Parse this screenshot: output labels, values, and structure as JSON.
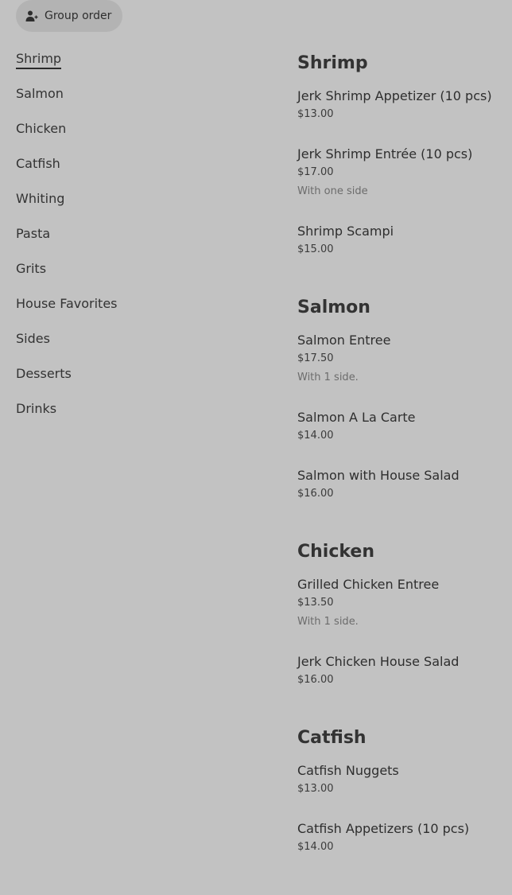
{
  "group_order": {
    "label": "Group order",
    "icon": "person-add-icon"
  },
  "nav": {
    "items": [
      {
        "label": "Shrimp",
        "active": true
      },
      {
        "label": "Salmon"
      },
      {
        "label": "Chicken"
      },
      {
        "label": "Catfish"
      },
      {
        "label": "Whiting"
      },
      {
        "label": "Pasta"
      },
      {
        "label": "Grits"
      },
      {
        "label": "House Favorites"
      },
      {
        "label": "Sides"
      },
      {
        "label": "Desserts"
      },
      {
        "label": "Drinks"
      }
    ]
  },
  "menu": {
    "categories": [
      {
        "title": "Shrimp",
        "items": [
          {
            "name": "Jerk Shrimp Appetizer (10 pcs)",
            "price": "$13.00"
          },
          {
            "name": "Jerk Shrimp Entrée (10 pcs)",
            "price": "$17.00",
            "desc": "With one side"
          },
          {
            "name": "Shrimp Scampi",
            "price": "$15.00"
          }
        ]
      },
      {
        "title": "Salmon",
        "items": [
          {
            "name": "Salmon Entree",
            "price": "$17.50",
            "desc": "With 1 side."
          },
          {
            "name": "Salmon A La Carte",
            "price": "$14.00"
          },
          {
            "name": "Salmon with House Salad",
            "price": "$16.00"
          }
        ]
      },
      {
        "title": "Chicken",
        "items": [
          {
            "name": "Grilled Chicken Entree",
            "price": "$13.50",
            "desc": "With 1 side."
          },
          {
            "name": "Jerk Chicken House Salad",
            "price": "$16.00"
          }
        ]
      },
      {
        "title": "Catfish",
        "items": [
          {
            "name": "Catfish Nuggets",
            "price": "$13.00"
          },
          {
            "name": "Catfish Appetizers (10 pcs)",
            "price": "$14.00"
          }
        ]
      }
    ]
  }
}
